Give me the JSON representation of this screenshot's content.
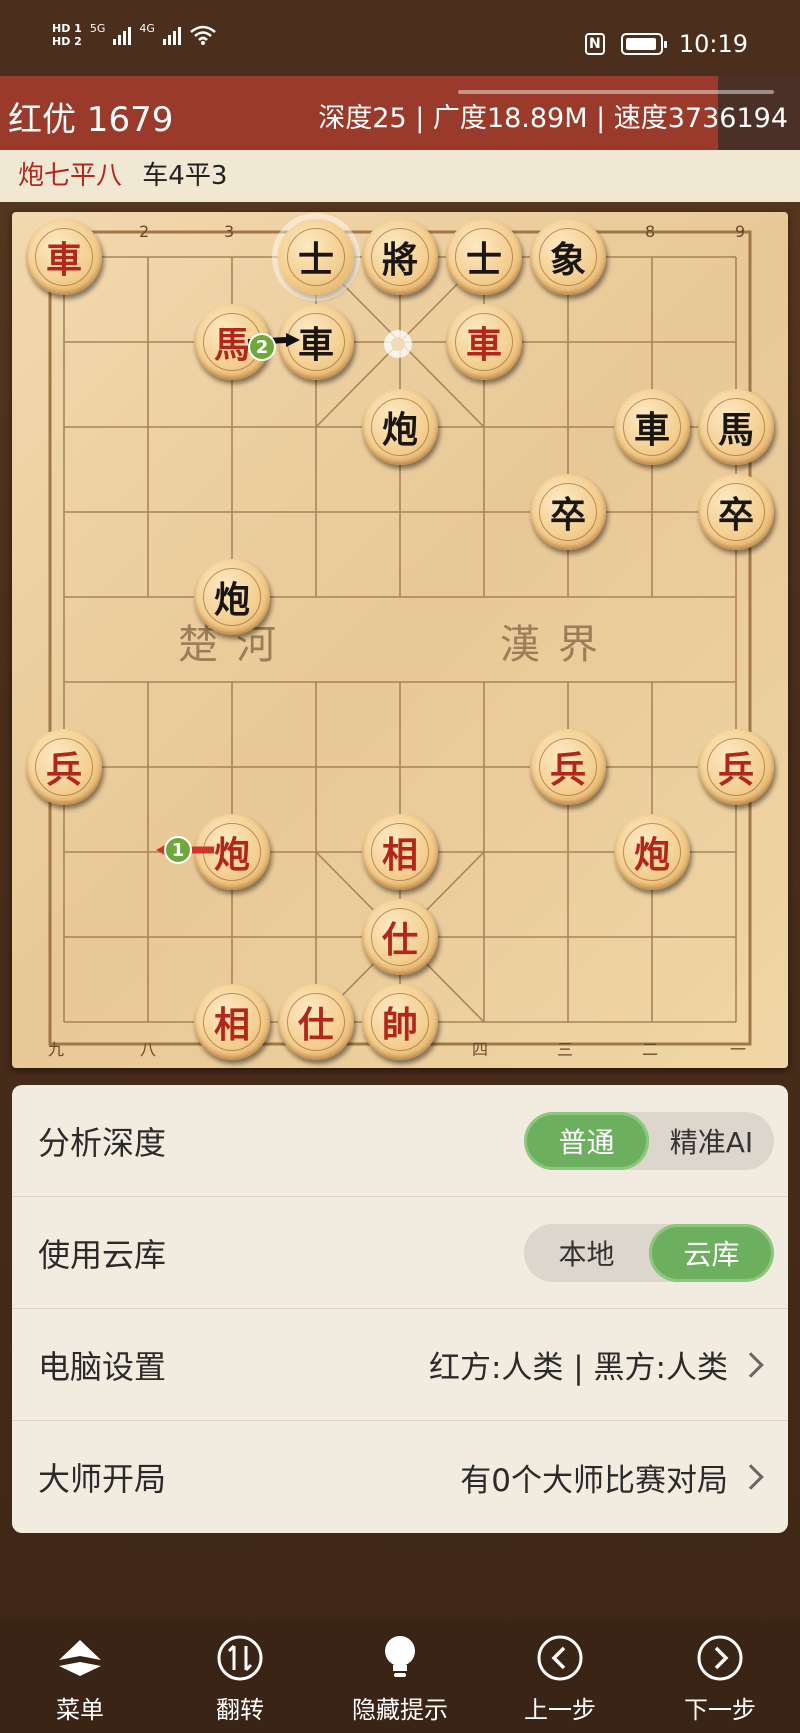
{
  "status_bar": {
    "hd1": "HD 1",
    "hd2": "HD 2",
    "net1": "5G",
    "net2": "4G",
    "nfc": "N",
    "time": "10:19"
  },
  "analysis": {
    "score": "红优 1679",
    "stats": "深度25 | 广度18.89M | 速度3736194"
  },
  "moves": {
    "red": "炮七平八",
    "black": "车4平3"
  },
  "board": {
    "top_labels": [
      "2",
      "3",
      "8",
      "9"
    ],
    "bottom_labels": [
      "九",
      "八",
      "四",
      "三",
      "二",
      "一"
    ],
    "river_left": "楚河",
    "river_right": "漢界",
    "badge1": "1",
    "badge2": "2",
    "pieces": [
      {
        "ch": "車",
        "side": "red",
        "col": 0,
        "row": 0
      },
      {
        "ch": "士",
        "side": "black",
        "col": 3,
        "row": 0,
        "selected": true
      },
      {
        "ch": "將",
        "side": "black",
        "col": 4,
        "row": 0
      },
      {
        "ch": "士",
        "side": "black",
        "col": 5,
        "row": 0
      },
      {
        "ch": "象",
        "side": "black",
        "col": 6,
        "row": 0
      },
      {
        "ch": "馬",
        "side": "red",
        "col": 2,
        "row": 1
      },
      {
        "ch": "車",
        "side": "black",
        "col": 3,
        "row": 1
      },
      {
        "ch": "車",
        "side": "red",
        "col": 5,
        "row": 1
      },
      {
        "ch": "炮",
        "side": "black",
        "col": 4,
        "row": 2
      },
      {
        "ch": "車",
        "side": "black",
        "col": 7,
        "row": 2
      },
      {
        "ch": "馬",
        "side": "black",
        "col": 8,
        "row": 2
      },
      {
        "ch": "卒",
        "side": "black",
        "col": 6,
        "row": 3
      },
      {
        "ch": "卒",
        "side": "black",
        "col": 8,
        "row": 3
      },
      {
        "ch": "炮",
        "side": "black",
        "col": 2,
        "row": 4
      },
      {
        "ch": "兵",
        "side": "red",
        "col": 0,
        "row": 6
      },
      {
        "ch": "兵",
        "side": "red",
        "col": 6,
        "row": 6
      },
      {
        "ch": "兵",
        "side": "red",
        "col": 8,
        "row": 6
      },
      {
        "ch": "炮",
        "side": "red",
        "col": 2,
        "row": 7
      },
      {
        "ch": "相",
        "side": "red",
        "col": 4,
        "row": 7
      },
      {
        "ch": "炮",
        "side": "red",
        "col": 7,
        "row": 7
      },
      {
        "ch": "仕",
        "side": "red",
        "col": 4,
        "row": 8
      },
      {
        "ch": "相",
        "side": "red",
        "col": 2,
        "row": 9
      },
      {
        "ch": "仕",
        "side": "red",
        "col": 3,
        "row": 9
      },
      {
        "ch": "帥",
        "side": "red",
        "col": 4,
        "row": 9
      }
    ]
  },
  "settings": {
    "depth_label": "分析深度",
    "depth_opt1": "普通",
    "depth_opt2": "精准AI",
    "cloud_label": "使用云库",
    "cloud_opt1": "本地",
    "cloud_opt2": "云库",
    "computer_label": "电脑设置",
    "computer_value": "红方:人类 | 黑方:人类",
    "master_label": "大师开局",
    "master_value": "有0个大师比赛对局"
  },
  "nav": {
    "menu": "菜单",
    "flip": "翻转",
    "hint": "隐藏提示",
    "prev": "上一步",
    "next": "下一步"
  },
  "colors": {
    "header_red": "#9a3a2a",
    "toggle_green": "#6caf5f",
    "red_piece": "#b3271a"
  }
}
